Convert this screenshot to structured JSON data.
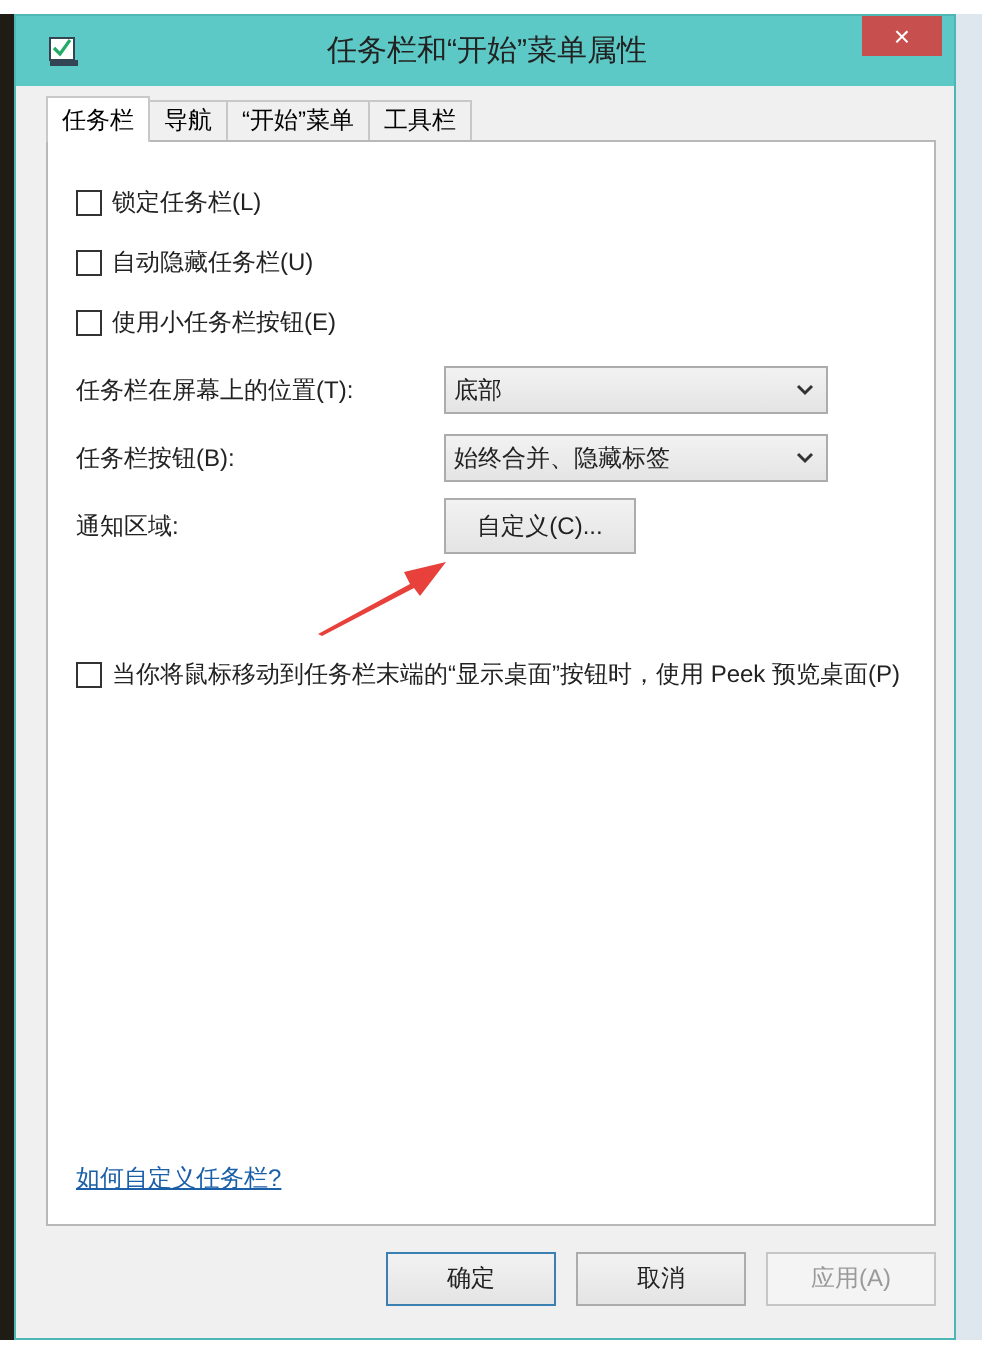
{
  "window": {
    "title": "任务栏和“开始”菜单属性",
    "close": "×"
  },
  "tabs": [
    {
      "label": "任务栏",
      "selected": true
    },
    {
      "label": "导航",
      "selected": false
    },
    {
      "label": "“开始”菜单",
      "selected": false
    },
    {
      "label": "工具栏",
      "selected": false
    }
  ],
  "checkboxes": [
    {
      "label": "锁定任务栏(L)",
      "checked": false
    },
    {
      "label": "自动隐藏任务栏(U)",
      "checked": false
    },
    {
      "label": "使用小任务栏按钮(E)",
      "checked": false
    }
  ],
  "settings": [
    {
      "kind": "dropdown",
      "label": "任务栏在屏幕上的位置(T):",
      "value": "底部"
    },
    {
      "kind": "dropdown",
      "label": "任务栏按钮(B):",
      "value": "始终合并、隐藏标签"
    },
    {
      "kind": "button",
      "label": "通知区域:",
      "value": "自定义(C)..."
    }
  ],
  "peek_checkbox": {
    "label": "当你将鼠标移动到任务栏末端的“显示桌面”按钮时，使用 Peek 预览桌面(P)",
    "checked": false
  },
  "help_link": "如何自定义任务栏?",
  "buttons": [
    {
      "label": "确定",
      "disabled": false
    },
    {
      "label": "取消",
      "disabled": false
    },
    {
      "label": "应用(A)",
      "disabled": true
    }
  ]
}
